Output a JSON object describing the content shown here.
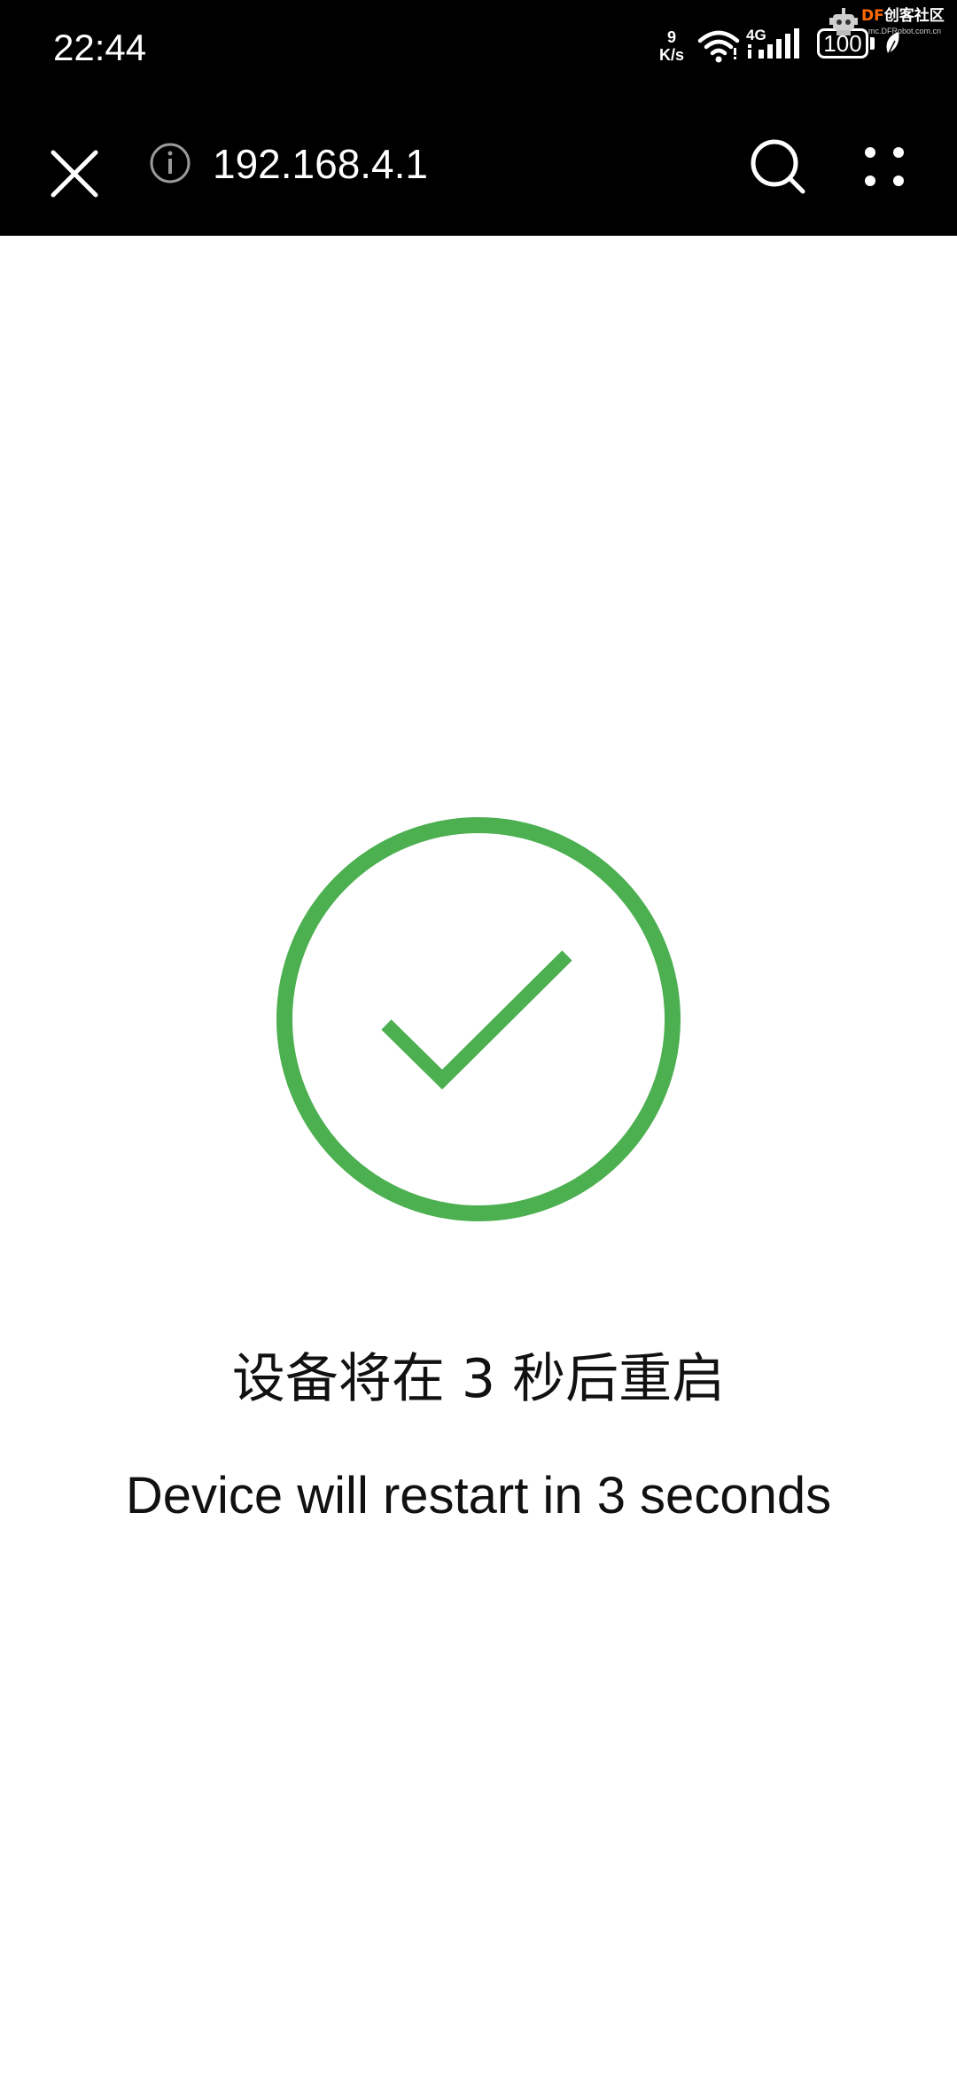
{
  "status_bar": {
    "time": "22:44",
    "net_speed_value": "9",
    "net_speed_unit": "K/s",
    "cell_type": "4G",
    "battery_level": "100",
    "icons": [
      "wifi-icon",
      "signal-icon",
      "battery-icon",
      "leaf-icon"
    ]
  },
  "watermark": {
    "brand_prefix": "DF",
    "brand_suffix": "创客社区",
    "url": "mc.DFRobot.com.cn"
  },
  "browser": {
    "url": "192.168.4.1",
    "icons": [
      "close-icon",
      "info-icon",
      "search-icon",
      "more-icon"
    ]
  },
  "content": {
    "message_zh": "设备将在 3 秒后重启",
    "message_en": "Device will restart in 3 seconds",
    "status_icon": "check-circle-icon",
    "accent_color": "#4caf50"
  }
}
